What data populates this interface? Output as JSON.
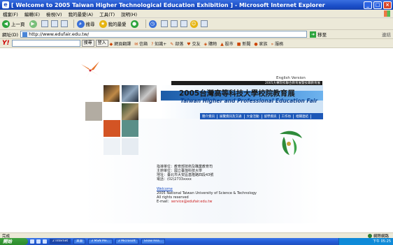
{
  "window": {
    "title": "[ Welcome to 2005 Taiwan Higher Technological Education Exhibition ] - Microsoft Internet Explorer",
    "controls": [
      "_",
      "□",
      "×"
    ]
  },
  "menu": [
    "檔案(F)",
    "編輯(E)",
    "檢視(V)",
    "我的最愛(A)",
    "工具(T)",
    "說明(H)"
  ],
  "toolbar": {
    "back": "上一頁",
    "search": "搜尋",
    "favorites": "我的最愛"
  },
  "address": {
    "label": "網址(D)",
    "url": "http://www.edufair.edu.tw/",
    "go": "移至",
    "links": "連結"
  },
  "yahoo": {
    "logo": "Y!",
    "search_btn": "搜尋",
    "button2": "登入",
    "items": [
      "網頁翻譯",
      "信箱",
      "知識+",
      "部落",
      "交友",
      "購物",
      "股市",
      "新聞",
      "家族",
      "服務"
    ]
  },
  "page": {
    "english_version": "English Version",
    "strip_text": "2005大專院校聯合教育展暨技職教育展",
    "title_zh": "2005台灣高等科技大學校院教育展",
    "title_en": "Taiwan Higher and Professional Education Fair",
    "nav": [
      "簡介資訊",
      "展覽資訊及交通",
      "大會活動",
      "留學資訊",
      "工作坊",
      "相關連結"
    ],
    "info_lines": [
      "指導單位：教育部技術及職業教育司",
      "主辦單位：國立臺灣科技大學",
      "地址：臺北市大安區基隆路四段43號",
      "電話：(02)2733xxxx"
    ],
    "info_link": "Welcome",
    "info_lines2": [
      "2005 National Taiwan University of Science & Technology",
      "All rights reserved",
      "E-mail："
    ],
    "email": "service@edufair.edu.tw"
  },
  "status": {
    "left": "完成",
    "zone": "網際網路"
  },
  "taskbar": {
    "start": "開始",
    "tasks": [
      "2 Internet",
      "桌面",
      "3 MSN Me...",
      "2 Microsoft",
      "Snow Rea..."
    ],
    "tray": "下午 05:25"
  },
  "colors": {
    "title_blue": "#1b4fc9",
    "nav_blue": "#1d58b8",
    "accent_orange": "#d35424",
    "accent_teal": "#5a8f88",
    "accent_gray": "#b2aca2"
  }
}
